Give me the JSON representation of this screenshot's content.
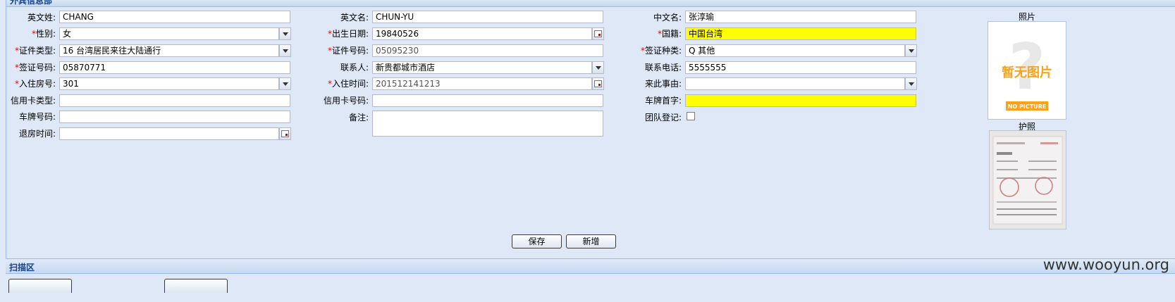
{
  "panel": {
    "title": "外宾信息部"
  },
  "form": {
    "last_name_en": {
      "label": "英文姓:",
      "value": "CHANG"
    },
    "first_name_en": {
      "label": "英文名:",
      "value": "CHUN-YU"
    },
    "name_cn": {
      "label": "中文名:",
      "value": "张淳瑜"
    },
    "gender": {
      "label": "性别:",
      "value": "女"
    },
    "birth_date": {
      "label": "出生日期:",
      "value": "19840526"
    },
    "nationality": {
      "label": "国籍:",
      "value": "中国台湾"
    },
    "id_type": {
      "label": "证件类型:",
      "value": "16  台湾居民来往大陆通行"
    },
    "id_number": {
      "label": "证件号码:",
      "value": "05095230"
    },
    "visa_type": {
      "label": "签证种类:",
      "value": "Q  其他"
    },
    "visa_number": {
      "label": "签证号码:",
      "value": "05870771"
    },
    "contact": {
      "label": "联系人:",
      "value": "新贵都城市酒店"
    },
    "phone": {
      "label": "联系电话:",
      "value": "5555555"
    },
    "room": {
      "label": "入住房号:",
      "value": "301"
    },
    "checkin_time": {
      "label": "入住时间:",
      "value": "201512141213"
    },
    "visit_reason": {
      "label": "来此事由:",
      "value": ""
    },
    "card_type": {
      "label": "信用卡类型:",
      "value": ""
    },
    "card_number": {
      "label": "信用卡号码:",
      "value": ""
    },
    "plate_prefix": {
      "label": "车牌首字:",
      "value": ""
    },
    "plate_number": {
      "label": "车牌号码:",
      "value": ""
    },
    "remark": {
      "label": "备注:",
      "value": ""
    },
    "group_reg": {
      "label": "团队登记:",
      "checked": false
    },
    "checkout_time": {
      "label": "退房时间:",
      "value": ""
    },
    "required_mark": "*"
  },
  "photos": {
    "photo_label": "照片",
    "photo_placeholder_cn": "暂无图片",
    "photo_placeholder_en": "NO PICTURE",
    "passport_label": "护照"
  },
  "buttons": {
    "save": "保存",
    "add": "新增"
  },
  "scan_section": {
    "title": "扫描区"
  },
  "colors": {
    "required": "#e00000",
    "highlight": "#ffff00",
    "panel_bg": "#dfe8f6",
    "header_text": "#15428b"
  },
  "watermark": "www.wooyun.org"
}
